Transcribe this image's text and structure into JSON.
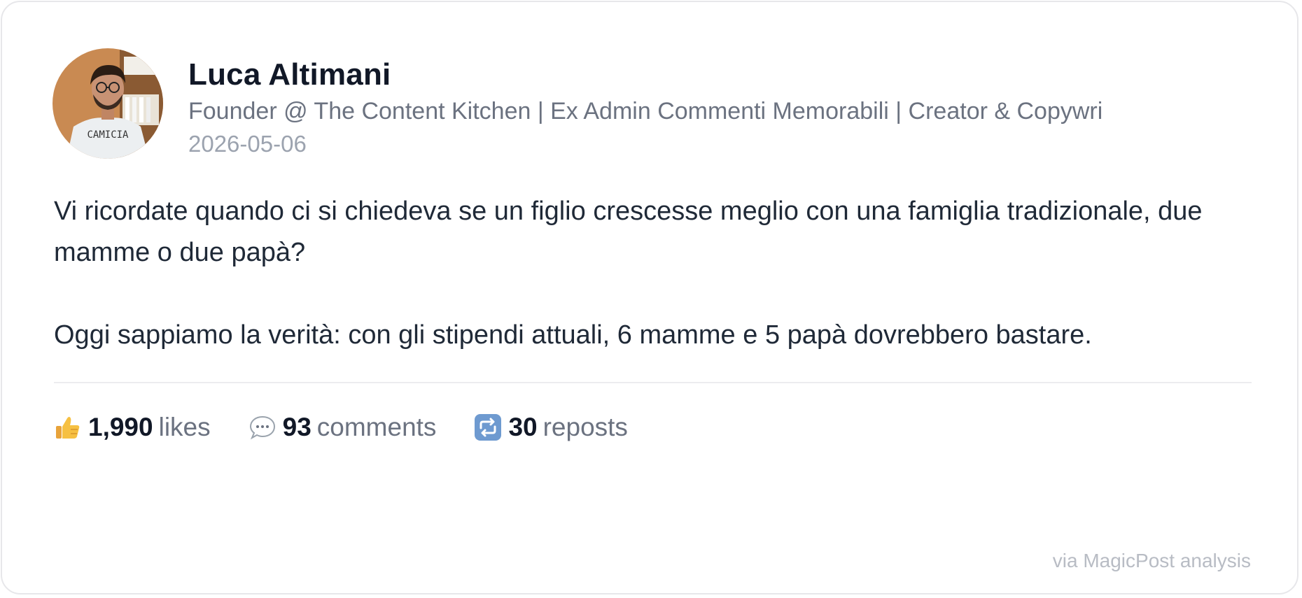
{
  "author": {
    "name": "Luca Altimani",
    "headline": "Founder @ The Content Kitchen | Ex Admin Commenti Memorabili | Creator & Copywri",
    "date": "2026-05-06",
    "avatar_shirt_text": "CAMICIA"
  },
  "post": {
    "paragraphs": [
      "Vi ricordate quando ci si chiedeva se un figlio crescesse meglio con una famiglia tradizionale, due mamme o due papà?",
      "Oggi sappiamo la verità: con gli stipendi attuali, 6 mamme e 5 papà dovrebbero bastare."
    ]
  },
  "stats": {
    "likes": {
      "icon": "thumbs-up-icon",
      "count": "1,990",
      "label": "likes"
    },
    "comments": {
      "icon": "speech-bubble-icon",
      "count": "93",
      "label": "comments"
    },
    "reposts": {
      "icon": "repost-icon",
      "count": "30",
      "label": "reposts"
    }
  },
  "footer": {
    "text": "via MagicPost analysis"
  },
  "colors": {
    "name": "#111827",
    "secondary": "#6b7280",
    "muted": "#9ca3af",
    "repost_icon_bg": "#6e9ad0",
    "like_icon": "#f6b93b"
  }
}
